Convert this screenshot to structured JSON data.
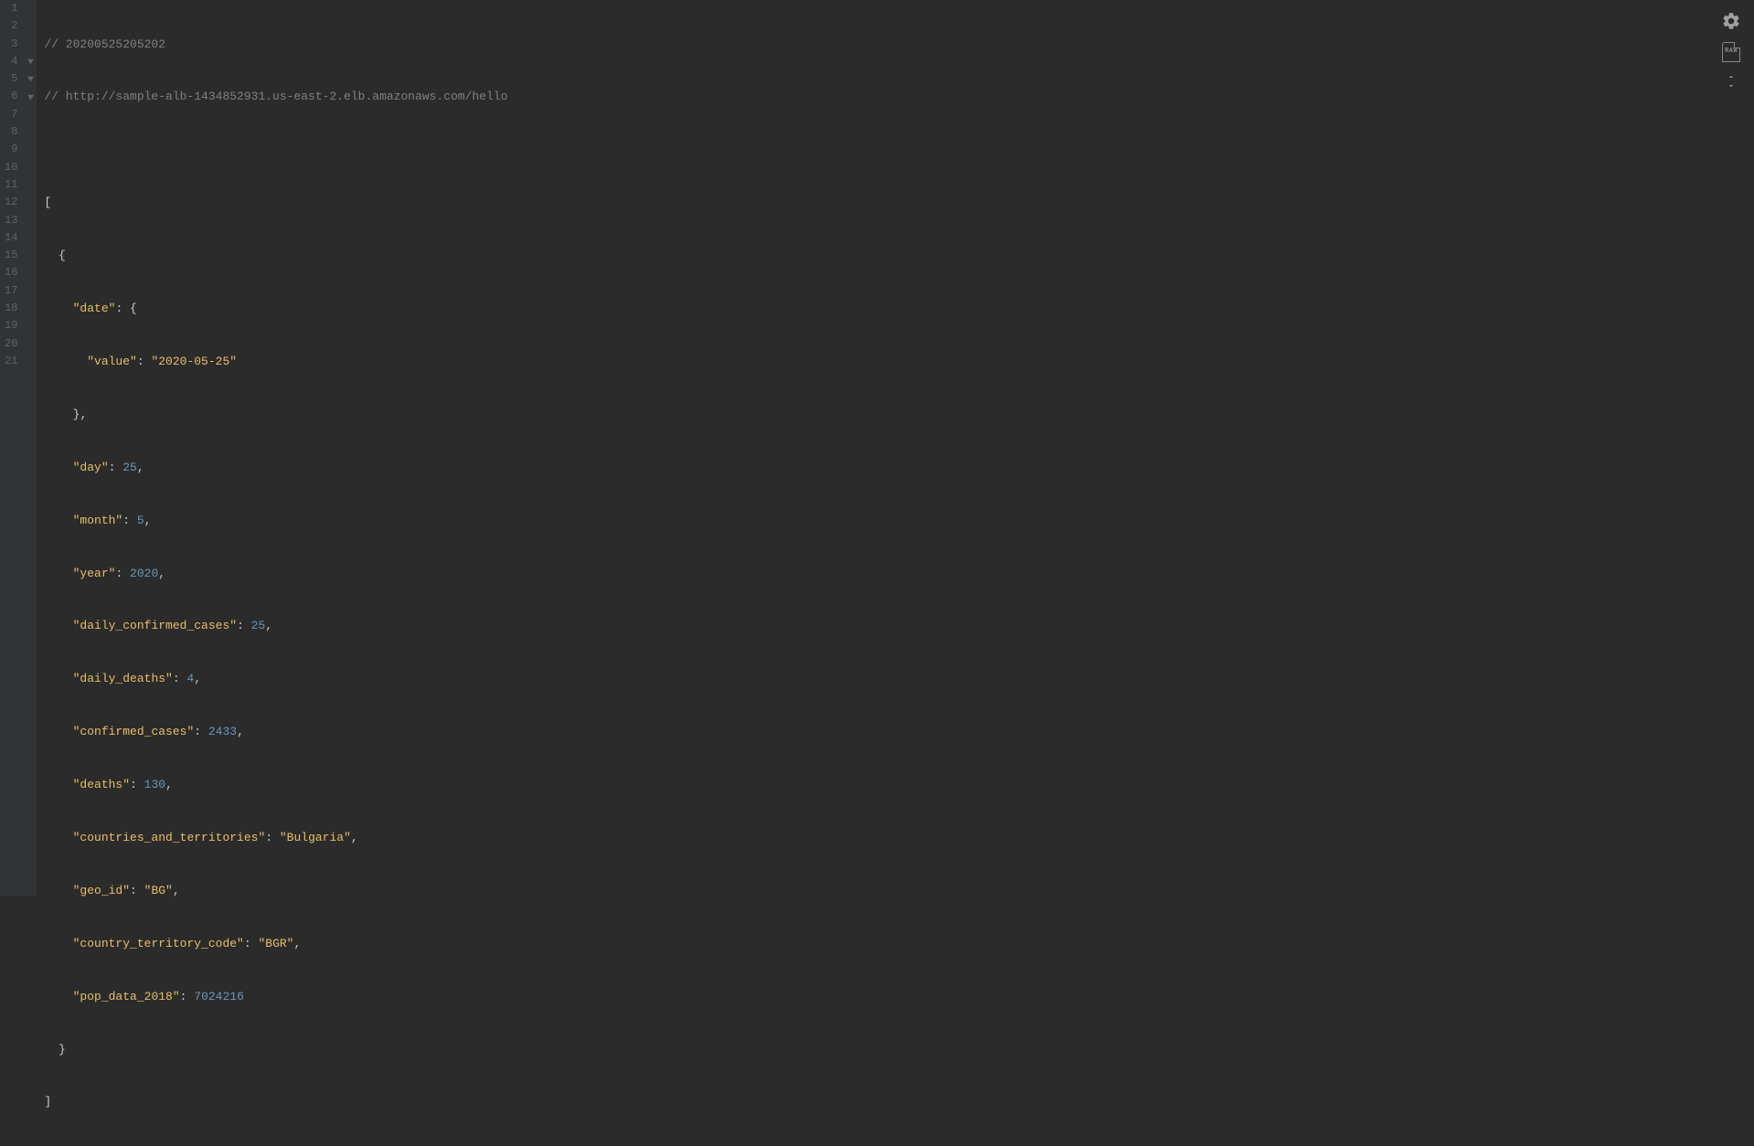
{
  "comments": {
    "timestamp": "// 20200525205202",
    "url": "// http://sample-alb-1434852931.us-east-2.elb.amazonaws.com/hello"
  },
  "json": {
    "key_date": "\"date\"",
    "key_value": "\"value\"",
    "val_value": "\"2020-05-25\"",
    "key_day": "\"day\"",
    "val_day": "25",
    "key_month": "\"month\"",
    "val_month": "5",
    "key_year": "\"year\"",
    "val_year": "2020",
    "key_dcc": "\"daily_confirmed_cases\"",
    "val_dcc": "25",
    "key_dd": "\"daily_deaths\"",
    "val_dd": "4",
    "key_cc": "\"confirmed_cases\"",
    "val_cc": "2433",
    "key_deaths": "\"deaths\"",
    "val_deaths": "130",
    "key_cat": "\"countries_and_territories\"",
    "val_cat": "\"Bulgaria\"",
    "key_geo": "\"geo_id\"",
    "val_geo": "\"BG\"",
    "key_ctc": "\"country_territory_code\"",
    "val_ctc": "\"BGR\"",
    "key_pop": "\"pop_data_2018\"",
    "val_pop": "7024216"
  },
  "lineNumbers": [
    "1",
    "2",
    "3",
    "4",
    "5",
    "6",
    "7",
    "8",
    "9",
    "10",
    "11",
    "12",
    "13",
    "14",
    "15",
    "16",
    "17",
    "18",
    "19",
    "20",
    "21"
  ],
  "foldable": [
    4,
    5,
    6
  ],
  "rawLabel": "RAW"
}
